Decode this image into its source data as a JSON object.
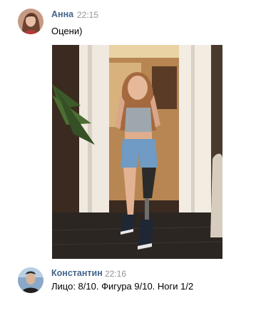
{
  "messages": [
    {
      "author": "Анна",
      "time": "22:15",
      "text": "Оцени)",
      "avatar_icon": "user-photo-avatar",
      "attachment": {
        "type": "photo",
        "icon": "photo-attachment"
      }
    },
    {
      "author": "Константин",
      "time": "22:16",
      "text": "Лицо: 8/10. Фигура 9/10. Ноги 1/2",
      "avatar_icon": "user-photo-avatar"
    }
  ],
  "colors": {
    "author_name": "#42648b",
    "timestamp": "#939393",
    "text": "#000000",
    "background": "#ffffff"
  }
}
